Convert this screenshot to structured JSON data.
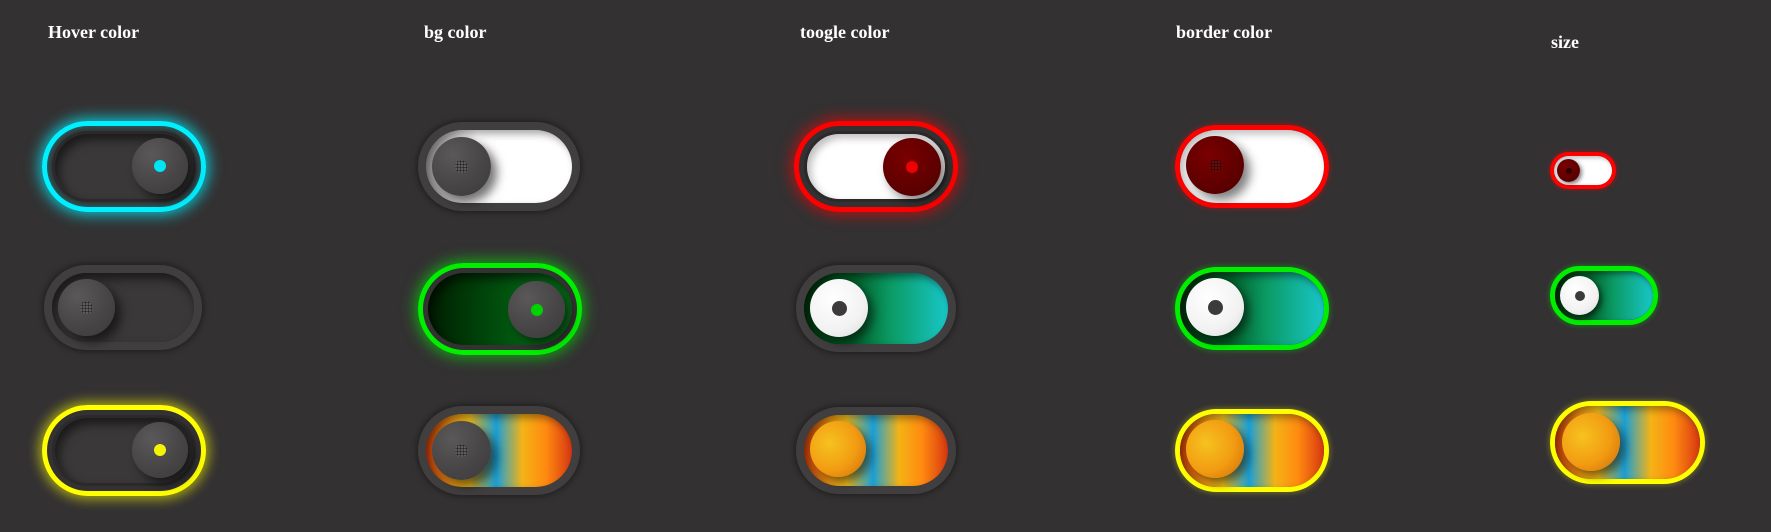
{
  "columns": [
    {
      "title": "Hover color"
    },
    {
      "title": "bg color"
    },
    {
      "title": "toogle color"
    },
    {
      "title": "border color"
    },
    {
      "title": "size"
    }
  ],
  "colors": {
    "background": "#333132",
    "cyan": "#00f0ff",
    "green": "#00ee00",
    "yellow": "#ffff00",
    "red": "#ff0000",
    "dark_red": "#6b0000",
    "frame": "#403e3f"
  },
  "toggles": {
    "hover_cyan": {
      "state": "on"
    },
    "hover_none": {
      "state": "off"
    },
    "hover_yellow": {
      "state": "on"
    },
    "bg_white": {
      "state": "off"
    },
    "bg_green": {
      "state": "on"
    },
    "bg_rainbow": {
      "state": "off"
    },
    "toggle_red": {
      "state": "on"
    },
    "toggle_white": {
      "state": "off"
    },
    "toggle_rainbow": {
      "state": "off"
    },
    "border_red": {
      "state": "off"
    },
    "border_green": {
      "state": "off"
    },
    "border_yellow": {
      "state": "off"
    },
    "size_small": {
      "state": "off"
    },
    "size_medium": {
      "state": "off"
    },
    "size_large": {
      "state": "off"
    }
  }
}
